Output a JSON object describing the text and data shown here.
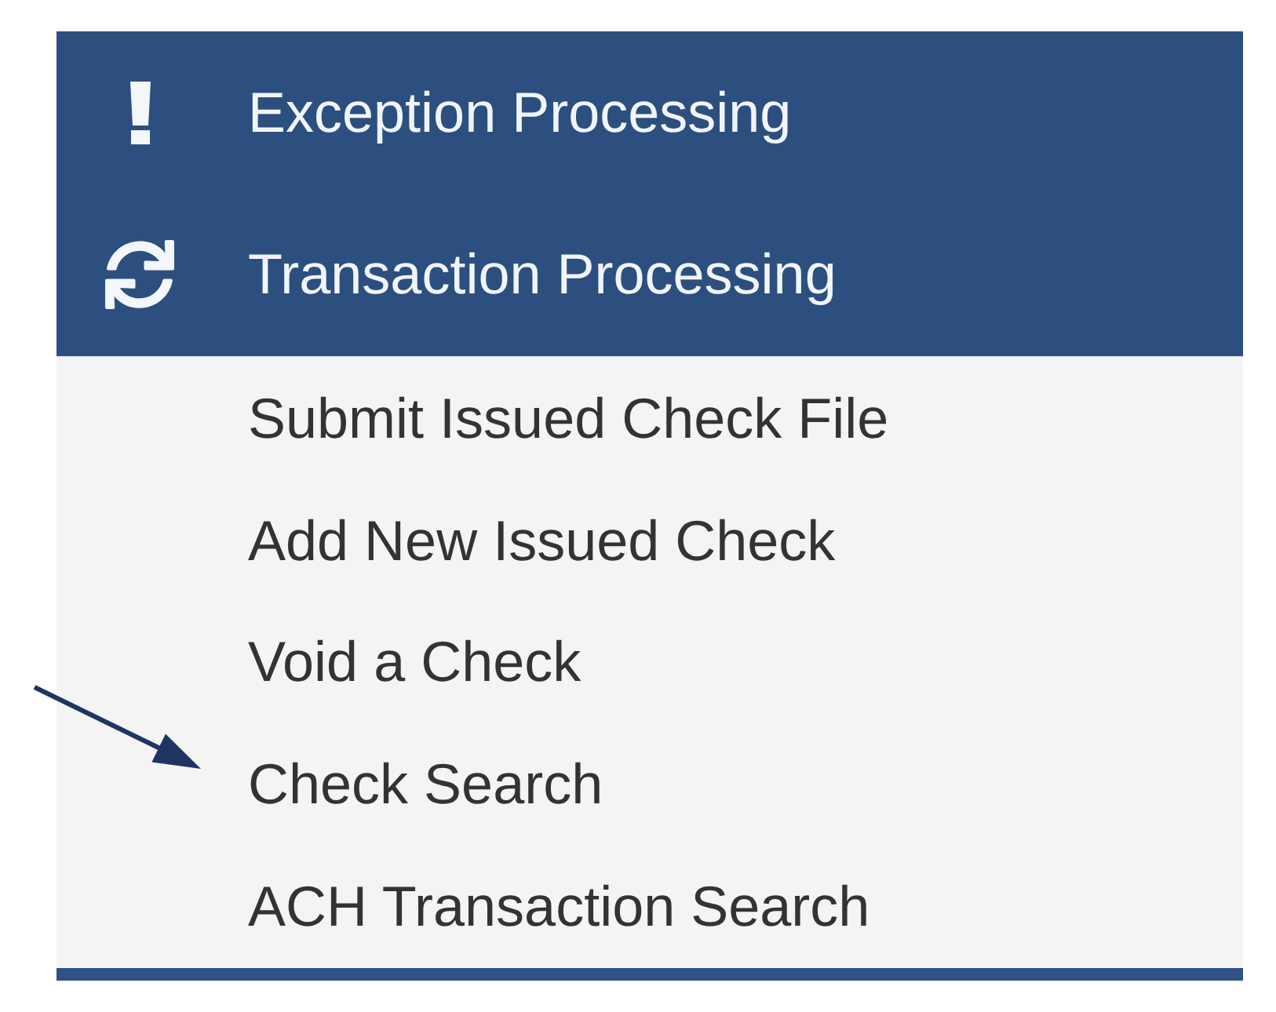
{
  "menu": {
    "items": [
      {
        "label": "Exception Processing"
      },
      {
        "label": "Transaction Processing",
        "children": [
          {
            "label": "Submit Issued Check File"
          },
          {
            "label": "Add New Issued Check"
          },
          {
            "label": "Void a Check"
          },
          {
            "label": "Check Search"
          },
          {
            "label": "ACH Transaction Search"
          }
        ]
      }
    ]
  }
}
